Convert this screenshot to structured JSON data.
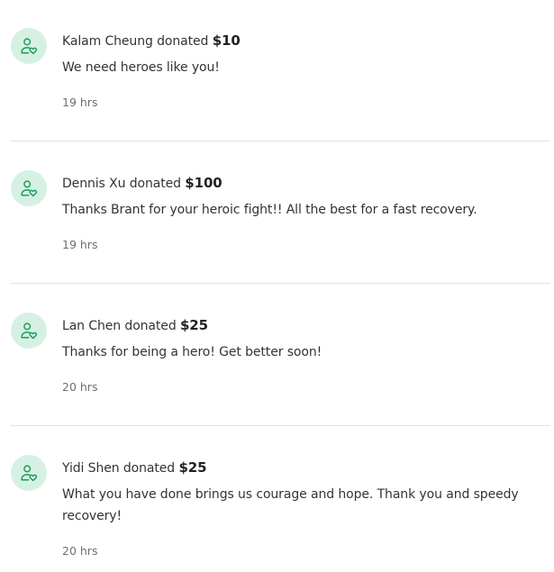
{
  "donations": [
    {
      "name": "Kalam Cheung",
      "verb": "donated",
      "amount": "$10",
      "message": "We need heroes like you!",
      "time": "19 hrs",
      "icon": "donor-heart-icon"
    },
    {
      "name": "Dennis Xu",
      "verb": "donated",
      "amount": "$100",
      "message": "Thanks Brant for your heroic fight!! All the best for a fast recovery.",
      "time": "19 hrs",
      "icon": "donor-heart-icon"
    },
    {
      "name": "Lan Chen",
      "verb": "donated",
      "amount": "$25",
      "message": "Thanks for being a hero! Get better soon!",
      "time": "20 hrs",
      "icon": "donor-heart-icon"
    },
    {
      "name": "Yidi Shen",
      "verb": "donated",
      "amount": "$25",
      "message": "What you have done brings us courage and hope. Thank you and speedy recovery!",
      "time": "20 hrs",
      "icon": "donor-heart-icon"
    }
  ],
  "colors": {
    "avatar_bg": "#d6f1e4",
    "icon_green": "#1a9d5c",
    "divider": "#e2e2e2",
    "muted_text": "#6f6f6f"
  }
}
